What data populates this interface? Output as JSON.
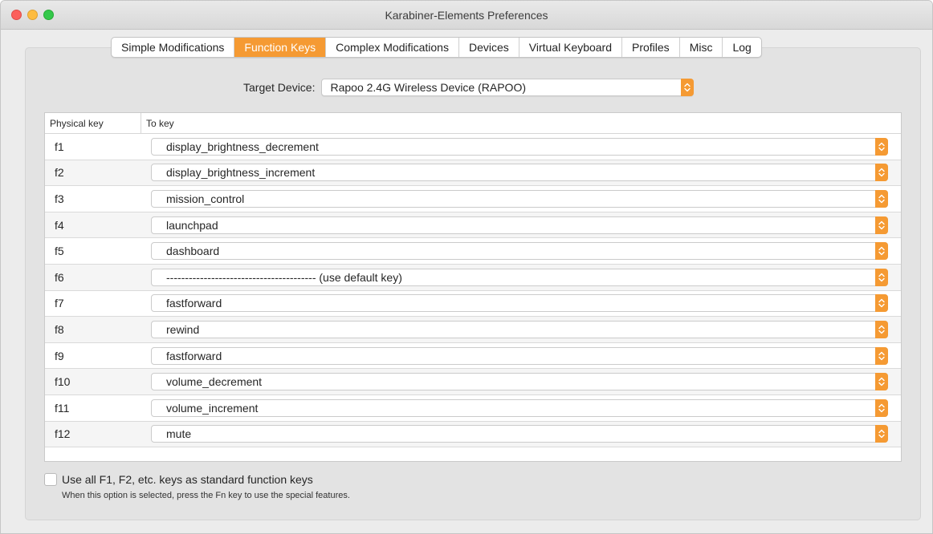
{
  "window": {
    "title": "Karabiner-Elements Preferences"
  },
  "tabs": [
    {
      "label": "Simple Modifications",
      "active": false
    },
    {
      "label": "Function Keys",
      "active": true
    },
    {
      "label": "Complex Modifications",
      "active": false
    },
    {
      "label": "Devices",
      "active": false
    },
    {
      "label": "Virtual Keyboard",
      "active": false
    },
    {
      "label": "Profiles",
      "active": false
    },
    {
      "label": "Misc",
      "active": false
    },
    {
      "label": "Log",
      "active": false
    }
  ],
  "target": {
    "label": "Target Device:",
    "value": "Rapoo 2.4G Wireless Device (RAPOO)"
  },
  "table": {
    "headers": {
      "physical": "Physical key",
      "to": "To key"
    },
    "rows": [
      {
        "key": "f1",
        "to": "display_brightness_decrement"
      },
      {
        "key": "f2",
        "to": "display_brightness_increment"
      },
      {
        "key": "f3",
        "to": "mission_control"
      },
      {
        "key": "f4",
        "to": "launchpad"
      },
      {
        "key": "f5",
        "to": "dashboard"
      },
      {
        "key": "f6",
        "to": "---------------------------------------- (use default key)"
      },
      {
        "key": "f7",
        "to": "fastforward"
      },
      {
        "key": "f8",
        "to": "rewind"
      },
      {
        "key": "f9",
        "to": "fastforward"
      },
      {
        "key": "f10",
        "to": "volume_decrement"
      },
      {
        "key": "f11",
        "to": "volume_increment"
      },
      {
        "key": "f12",
        "to": "mute"
      }
    ]
  },
  "option": {
    "label": "Use all F1, F2, etc. keys as standard function keys",
    "help": "When this option is selected, press the Fn key to use the special features.",
    "checked": false
  },
  "colors": {
    "accent": "#f59a33",
    "background": "#ececec"
  }
}
